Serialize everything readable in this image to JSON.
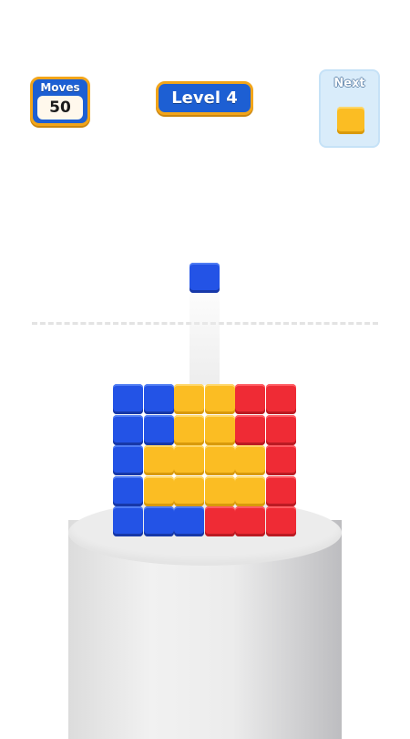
{
  "hud": {
    "moves_label": "Moves",
    "moves_value": "50",
    "level_label": "Level 4",
    "next_label": "Next",
    "next_piece_color": "yellow"
  },
  "falling_block": {
    "color": "blue",
    "column": 3
  },
  "colors": {
    "blue": "#2353e6",
    "yellow": "#fbbd23",
    "red": "#ef2b35"
  },
  "board": {
    "rows": [
      [
        "blue",
        "blue",
        "yellow",
        "yellow",
        "red",
        "red"
      ],
      [
        "blue",
        "blue",
        "yellow",
        "yellow",
        "red",
        "red"
      ],
      [
        "blue",
        "yellow",
        "yellow",
        "yellow",
        "yellow",
        "red"
      ],
      [
        "blue",
        "yellow",
        "yellow",
        "yellow",
        "yellow",
        "red"
      ],
      [
        "blue",
        "blue",
        "blue",
        "red",
        "red",
        "red"
      ]
    ]
  }
}
